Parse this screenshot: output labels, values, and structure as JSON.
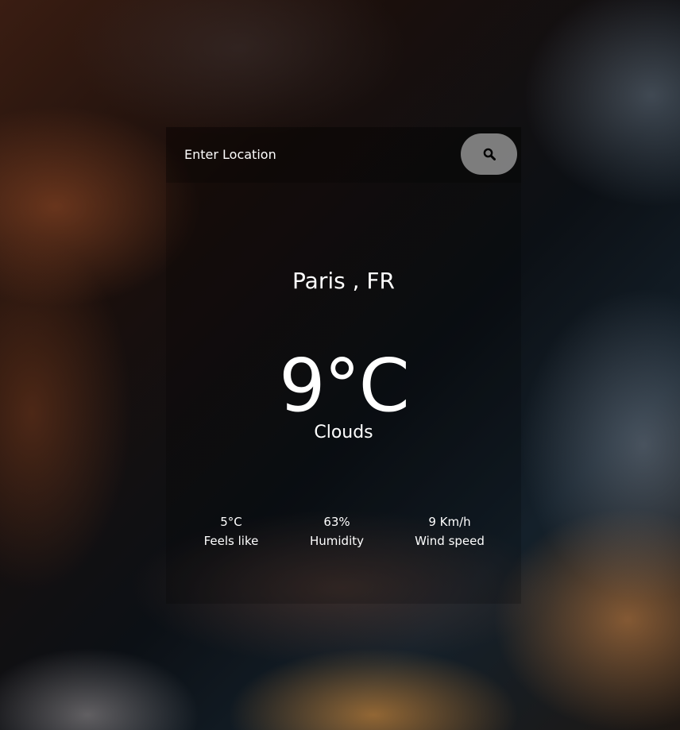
{
  "search": {
    "placeholder": "Enter Location",
    "button_icon": "search-icon"
  },
  "weather": {
    "location": "Paris , FR",
    "temperature": "9°C",
    "description": "Clouds"
  },
  "stats": [
    {
      "value": "5°C",
      "label": "Feels like"
    },
    {
      "value": "63%",
      "label": "Humidity"
    },
    {
      "value": "9 Km/h",
      "label": "Wind speed"
    }
  ],
  "colors": {
    "text": "#ffffff",
    "button_bg": "#aaaaaa"
  }
}
